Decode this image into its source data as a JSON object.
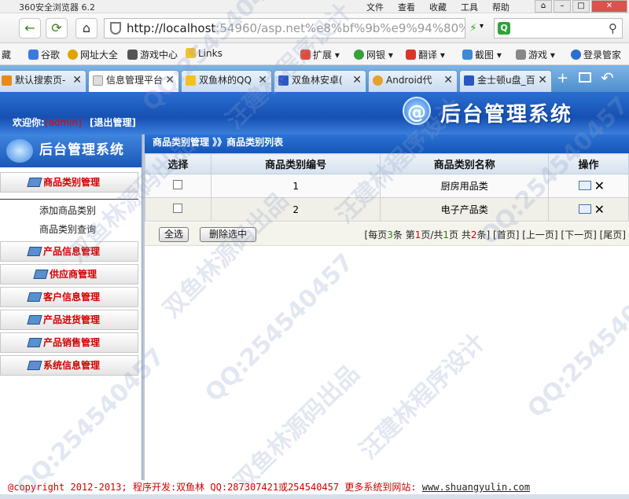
{
  "browser": {
    "title": "360安全浏览器 6.2",
    "menu": [
      "文件",
      "查看",
      "收藏",
      "工具",
      "帮助"
    ],
    "url_host": "http://localhost",
    "url_rest": ":54960/asp.net%e8%bf%9b%e9%94%80%",
    "bookmarks": [
      "谷歌",
      "网址大全",
      "游戏中心",
      "Links",
      "扩展",
      "网银",
      "翻译",
      "截图",
      "游戏",
      "登录管家"
    ],
    "bookmark_first": "藏",
    "tabs": [
      "默认搜索页-",
      "信息管理平台",
      "双鱼林的QQ",
      "双鱼林安卓(",
      "Android代",
      "金士顿u盘_百"
    ]
  },
  "header": {
    "welcome": "欢迎你:",
    "user": "[admin]",
    "logout": "[退出管理]",
    "brand_logo": "@",
    "brand_title": "后台管理系统"
  },
  "sidebar": {
    "logo_text": "后台管理系统",
    "sections": [
      {
        "label": "商品类别管理"
      },
      {
        "label": "产品信息管理"
      },
      {
        "label": "供应商管理"
      },
      {
        "label": "客户信息管理"
      },
      {
        "label": "产品进货管理"
      },
      {
        "label": "产品销售管理"
      },
      {
        "label": "系统信息管理"
      }
    ],
    "subitems": [
      "添加商品类别",
      "商品类别查询"
    ]
  },
  "main": {
    "breadcrumb": "商品类别管理 》》商品类别列表",
    "columns": [
      "选择",
      "商品类别编号",
      "商品类别名称",
      "操作"
    ],
    "rows": [
      {
        "id": "1",
        "name": "厨房用品类"
      },
      {
        "id": "2",
        "name": "电子产品类"
      }
    ],
    "select_all": "全选",
    "delete_selected": "删除选中",
    "pager": {
      "per_page_pre": "[每页",
      "per_page_num": "3",
      "per_page_post": "条 第",
      "cur_page": "1",
      "page_sep": "页/共",
      "total_pages": "1",
      "total_mid": "页 共",
      "total_items": "2",
      "total_post": "条]",
      "first": "[首页]",
      "prev": "[上一页]",
      "next": "[下一页]",
      "last": "[尾页]"
    }
  },
  "footer": {
    "copyright": "@copyright 2012-2013; 程序开发:双鱼林  QQ:287307421或254540457  更多系统到网站: ",
    "site": "www.shuangyulin.com"
  },
  "watermarks": [
    "QQ:254540457",
    "汪建林程序设计",
    "双鱼林源码出品"
  ],
  "colors": {
    "accent_blue": "#1550b2",
    "menu_red": "#d40000",
    "pager_green": "#2a7d12"
  }
}
